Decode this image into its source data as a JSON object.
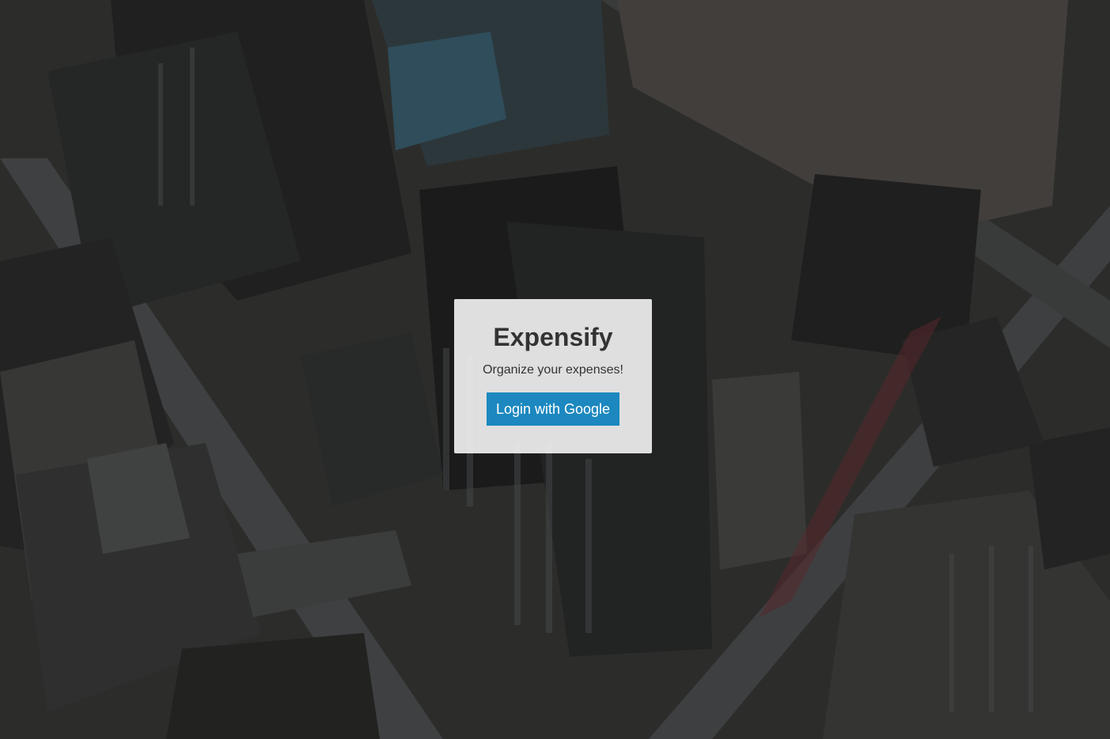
{
  "app": {
    "title": "Expensify",
    "subtitle": "Organize your expenses!",
    "login_button_label": "Login with Google"
  },
  "colors": {
    "button_bg": "#1c88bf",
    "button_text": "#ffffff",
    "box_bg": "#f0f0f0",
    "text": "#333333"
  },
  "background": {
    "description_icon": "aerial-city-background-image"
  }
}
